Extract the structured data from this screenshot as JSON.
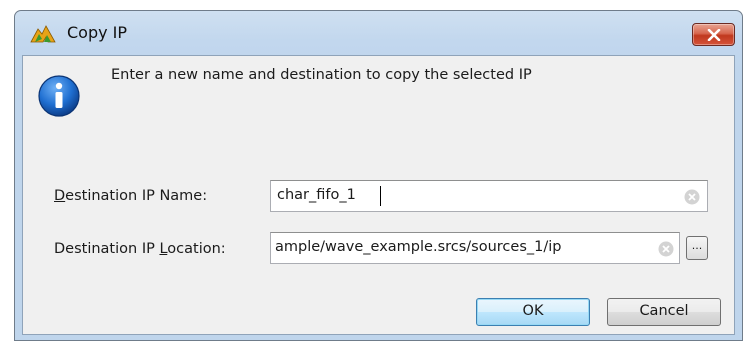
{
  "window": {
    "title": "Copy IP",
    "app_icon": "vivado-logo-icon",
    "close_icon": "close-icon"
  },
  "message": {
    "icon": "info-icon",
    "text": "Enter a new name and destination to copy the selected IP"
  },
  "fields": {
    "name": {
      "label_mnemonic": "D",
      "label_rest": "estination IP Name:",
      "value": "char_fifo_1"
    },
    "location": {
      "label_prefix": "Destination IP ",
      "label_mnemonic": "L",
      "label_rest": "ocation:",
      "value": "ample/wave_example.srcs/sources_1/ip",
      "browse_label": "..."
    }
  },
  "buttons": {
    "ok": "OK",
    "cancel": "Cancel"
  },
  "colors": {
    "title_bar": "#c2d7ee",
    "close_button": "#c0391e",
    "info_icon": "#1f6fd1",
    "default_button_border": "#3c7fb1"
  }
}
